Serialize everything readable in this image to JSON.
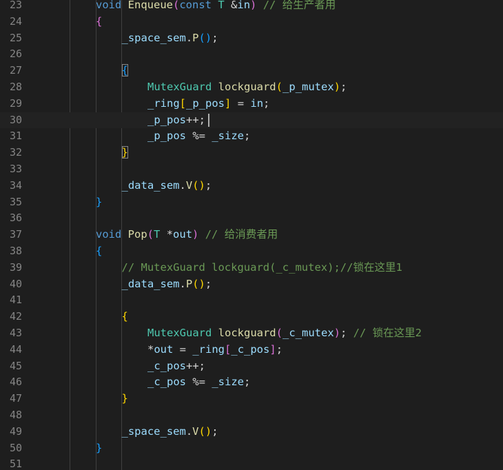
{
  "editor": {
    "colors": {
      "background": "#1e1e1e",
      "line_number": "#858585",
      "keyword": "#569cd6",
      "function": "#dcdcaa",
      "type": "#4ec9b0",
      "variable": "#9cdcfe",
      "comment": "#6a9955",
      "plain": "#d4d4d4",
      "bracket_gold": "#ffd700",
      "bracket_pink": "#da70d6",
      "bracket_blue": "#179fff"
    },
    "current_line_number": 30,
    "lines": [
      {
        "n": "23",
        "indent": 2,
        "tokens": [
          [
            "void ",
            "keyword"
          ],
          [
            "Enqueue",
            "function"
          ],
          [
            "(",
            "bracket_pink"
          ],
          [
            "const ",
            "keyword"
          ],
          [
            "T ",
            "type"
          ],
          [
            "&",
            "plain"
          ],
          [
            "in",
            "variable"
          ],
          [
            ") ",
            "bracket_pink"
          ],
          [
            "// 给生产者用",
            "comment"
          ]
        ]
      },
      {
        "n": "24",
        "indent": 2,
        "tokens": [
          [
            "{",
            "bracket_pink"
          ]
        ]
      },
      {
        "n": "25",
        "indent": 3,
        "tokens": [
          [
            "_space_sem",
            "variable"
          ],
          [
            ".",
            "plain"
          ],
          [
            "P",
            "function"
          ],
          [
            "()",
            "bracket_blue"
          ],
          [
            ";",
            "plain"
          ]
        ]
      },
      {
        "n": "26",
        "indent": 0,
        "tokens": []
      },
      {
        "n": "27",
        "indent": 3,
        "tokens": [
          [
            "{",
            "bracket_blue"
          ]
        ]
      },
      {
        "n": "28",
        "indent": 4,
        "tokens": [
          [
            "MutexGuard ",
            "type"
          ],
          [
            "lockguard",
            "function"
          ],
          [
            "(",
            "bracket_gold"
          ],
          [
            "_p_mutex",
            "variable"
          ],
          [
            ")",
            "bracket_gold"
          ],
          [
            ";",
            "plain"
          ]
        ]
      },
      {
        "n": "29",
        "indent": 4,
        "tokens": [
          [
            "_ring",
            "variable"
          ],
          [
            "[",
            "bracket_gold"
          ],
          [
            "_p_pos",
            "variable"
          ],
          [
            "]",
            "bracket_gold"
          ],
          [
            " = ",
            "plain"
          ],
          [
            "in",
            "variable"
          ],
          [
            ";",
            "plain"
          ]
        ]
      },
      {
        "n": "30",
        "indent": 4,
        "tokens": [
          [
            "_p_pos",
            "variable"
          ],
          [
            "++;",
            "plain"
          ]
        ]
      },
      {
        "n": "31",
        "indent": 4,
        "tokens": [
          [
            "_p_pos",
            "variable"
          ],
          [
            " %= ",
            "plain"
          ],
          [
            "_size",
            "variable"
          ],
          [
            ";",
            "plain"
          ]
        ]
      },
      {
        "n": "32",
        "indent": 3,
        "tokens": [
          [
            "}",
            "bracket_gold"
          ]
        ]
      },
      {
        "n": "33",
        "indent": 0,
        "tokens": []
      },
      {
        "n": "34",
        "indent": 3,
        "tokens": [
          [
            "_data_sem",
            "variable"
          ],
          [
            ".",
            "plain"
          ],
          [
            "V",
            "function"
          ],
          [
            "()",
            "bracket_gold"
          ],
          [
            ";",
            "plain"
          ]
        ]
      },
      {
        "n": "35",
        "indent": 2,
        "tokens": [
          [
            "}",
            "bracket_blue"
          ]
        ]
      },
      {
        "n": "36",
        "indent": 0,
        "tokens": []
      },
      {
        "n": "37",
        "indent": 2,
        "tokens": [
          [
            "void ",
            "keyword"
          ],
          [
            "Pop",
            "function"
          ],
          [
            "(",
            "bracket_pink"
          ],
          [
            "T ",
            "type"
          ],
          [
            "*",
            "plain"
          ],
          [
            "out",
            "variable"
          ],
          [
            ") ",
            "bracket_pink"
          ],
          [
            "// 给消费者用",
            "comment"
          ]
        ]
      },
      {
        "n": "38",
        "indent": 2,
        "tokens": [
          [
            "{",
            "bracket_blue"
          ]
        ]
      },
      {
        "n": "39",
        "indent": 3,
        "tokens": [
          [
            "// MutexGuard lockguard(_c_mutex);//锁在这里1",
            "comment"
          ]
        ]
      },
      {
        "n": "40",
        "indent": 3,
        "tokens": [
          [
            "_data_sem",
            "variable"
          ],
          [
            ".",
            "plain"
          ],
          [
            "P",
            "function"
          ],
          [
            "()",
            "bracket_gold"
          ],
          [
            ";",
            "plain"
          ]
        ]
      },
      {
        "n": "41",
        "indent": 0,
        "tokens": []
      },
      {
        "n": "42",
        "indent": 3,
        "tokens": [
          [
            "{",
            "bracket_gold"
          ]
        ]
      },
      {
        "n": "43",
        "indent": 4,
        "tokens": [
          [
            "MutexGuard ",
            "type"
          ],
          [
            "lockguard",
            "function"
          ],
          [
            "(",
            "bracket_pink"
          ],
          [
            "_c_mutex",
            "variable"
          ],
          [
            ")",
            "bracket_pink"
          ],
          [
            "; ",
            "plain"
          ],
          [
            "// 锁在这里2",
            "comment"
          ]
        ]
      },
      {
        "n": "44",
        "indent": 4,
        "tokens": [
          [
            "*",
            "plain"
          ],
          [
            "out",
            "variable"
          ],
          [
            " = ",
            "plain"
          ],
          [
            "_ring",
            "variable"
          ],
          [
            "[",
            "bracket_pink"
          ],
          [
            "_c_pos",
            "variable"
          ],
          [
            "]",
            "bracket_pink"
          ],
          [
            ";",
            "plain"
          ]
        ]
      },
      {
        "n": "45",
        "indent": 4,
        "tokens": [
          [
            "_c_pos",
            "variable"
          ],
          [
            "++;",
            "plain"
          ]
        ]
      },
      {
        "n": "46",
        "indent": 4,
        "tokens": [
          [
            "_c_pos",
            "variable"
          ],
          [
            " %= ",
            "plain"
          ],
          [
            "_size",
            "variable"
          ],
          [
            ";",
            "plain"
          ]
        ]
      },
      {
        "n": "47",
        "indent": 3,
        "tokens": [
          [
            "}",
            "bracket_gold"
          ]
        ]
      },
      {
        "n": "48",
        "indent": 0,
        "tokens": []
      },
      {
        "n": "49",
        "indent": 3,
        "tokens": [
          [
            "_space_sem",
            "variable"
          ],
          [
            ".",
            "plain"
          ],
          [
            "V",
            "function"
          ],
          [
            "()",
            "bracket_gold"
          ],
          [
            ";",
            "plain"
          ]
        ]
      },
      {
        "n": "50",
        "indent": 2,
        "tokens": [
          [
            "}",
            "bracket_blue"
          ]
        ]
      },
      {
        "n": "51",
        "indent": 0,
        "tokens": []
      }
    ]
  }
}
